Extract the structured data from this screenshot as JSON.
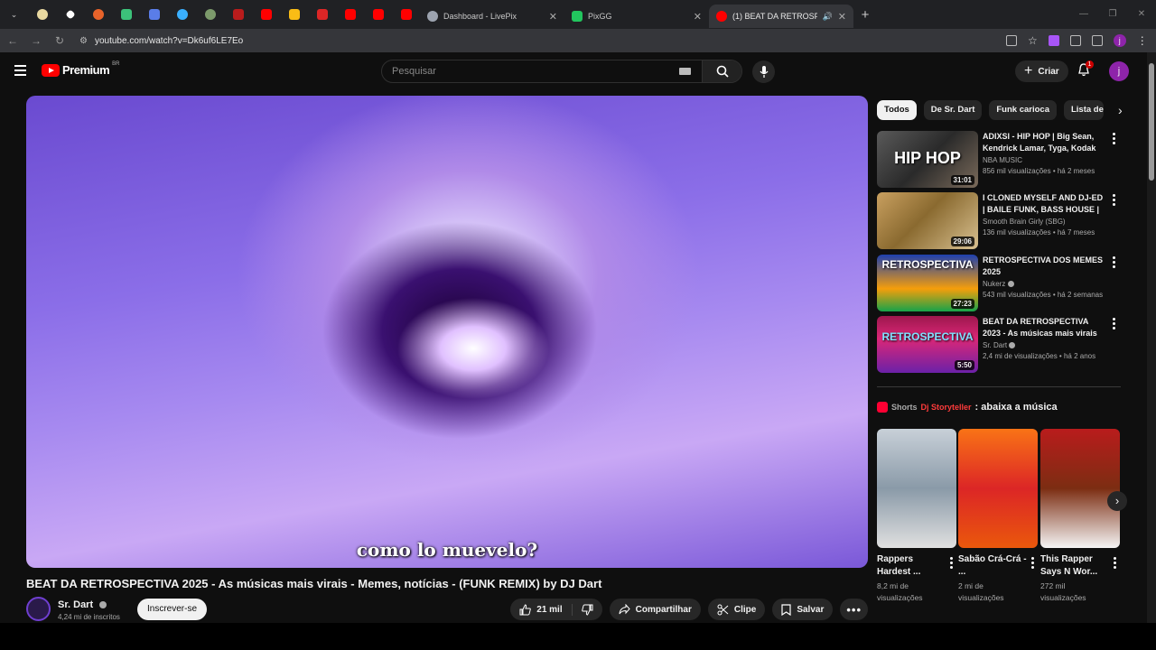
{
  "browser": {
    "tabs": [
      {
        "title": "Dashboard - LivePix",
        "fav_color": "#9ca3af"
      },
      {
        "title": "PixGG",
        "fav_color": "#22c55e"
      },
      {
        "title": "(1) BEAT DA RETROSPECTIVA",
        "fav_color": "#ff0000",
        "active": true
      }
    ],
    "url": "youtube.com/watch?v=Dk6uf6LE7Eo"
  },
  "masthead": {
    "logo_text": "Premium",
    "country_code": "BR",
    "search_placeholder": "Pesquisar",
    "create_label": "Criar",
    "notif_count": "1",
    "avatar_letter": "j"
  },
  "player": {
    "subtitle": "como lo muevelo?"
  },
  "video": {
    "title": "BEAT DA RETROSPECTIVA 2025 - As músicas mais virais - Memes, notícias - (FUNK REMIX) by DJ Dart",
    "channel": "Sr. Dart",
    "subscribers": "4,24 mi de inscritos",
    "subscribe_label": "Inscrever-se",
    "likes": "21 mil",
    "share_label": "Compartilhar",
    "clip_label": "Clipe",
    "save_label": "Salvar"
  },
  "chips": [
    "Todos",
    "De Sr. Dart",
    "Funk carioca",
    "Lista de"
  ],
  "recommendations": [
    {
      "title": "ADIXSI - HIP HOP | Big Sean, Kendrick Lamar, Tyga, Kodak ...",
      "channel": "NBA MUSIC",
      "views": "856 mil visualizações • há 2 meses",
      "duration": "31:01",
      "thumb_text": "HIP HOP"
    },
    {
      "title": "I CLONED MYSELF AND DJ-ED | BAILE FUNK, BASS HOUSE | ...",
      "channel": "Smooth Brain Girly (SBG)",
      "views": "136 mil visualizações • há 7 meses",
      "duration": "29:06",
      "thumb_text": ""
    },
    {
      "title": "RETROSPECTIVA DOS MEMES 2025",
      "channel": "Nukerz",
      "views": "543 mil visualizações • há 2 semanas",
      "duration": "27:23",
      "thumb_text": "RETROSPECTIVA"
    },
    {
      "title": "BEAT DA RETROSPECTIVA 2023 - As músicas mais virais ...",
      "channel": "Sr. Dart",
      "views": "2,4 mi de visualizações • há 2 anos",
      "duration": "5:50",
      "thumb_text": "RETROSPECTIVA"
    }
  ],
  "shorts_section": {
    "label": "Shorts",
    "overlay_text": "Dj Storyteller",
    "suffix": ": abaixa a música"
  },
  "shorts": [
    {
      "title": "Rappers Hardest ...",
      "views": "8,2 mi de visualizações"
    },
    {
      "title": "Sabão Crá-Crá - ...",
      "views": "2 mi de visualizações"
    },
    {
      "title": "This Rapper Says N Wor...",
      "views": "272 mil visualizações"
    }
  ]
}
